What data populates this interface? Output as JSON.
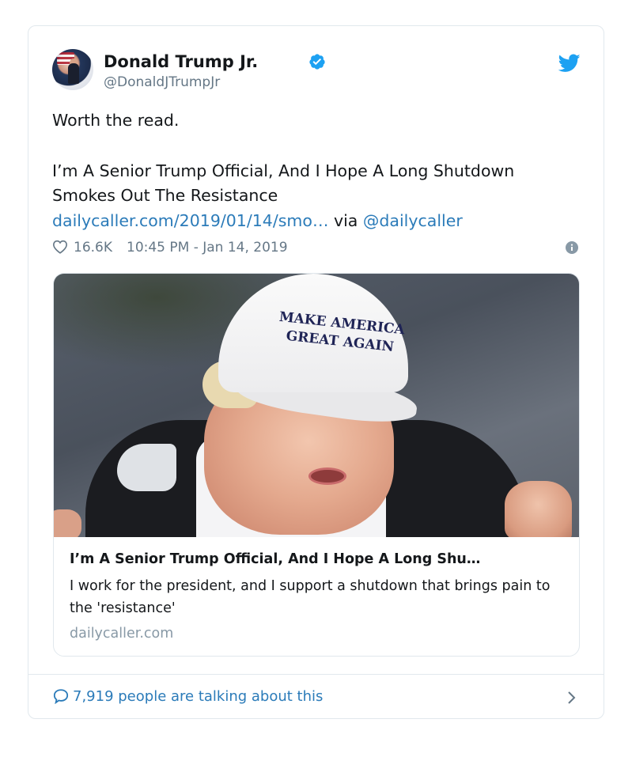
{
  "tweet": {
    "author_name": "Donald Trump Jr.",
    "handle": "@DonaldJTrumpJr",
    "body_lines": [
      "Worth the read.",
      "I’m A Senior Trump Official, And I Hope A Long Shutdown",
      "Smokes Out The Resistance"
    ],
    "link_text": "dailycaller.com/2019/01/14/smo…",
    "via_text": " via ",
    "mention": "@dailycaller",
    "likes": "16.6K",
    "timestamp": "10:45 PM - Jan 14, 2019"
  },
  "card": {
    "image_cap_line1": "MAKE AMERICA",
    "image_cap_line2": "GREAT AGAIN",
    "title": "I’m A Senior Trump Official, And I Hope A Long Shu…",
    "description": "I work for the president, and I support a shutdown that brings pain to the 'resistance'",
    "domain": "dailycaller.com"
  },
  "footer": {
    "talking_text": "7,919 people are talking about this"
  },
  "colors": {
    "link": "#2b7bb9",
    "secondary_text": "#657786",
    "verified_blue": "#1da1f2",
    "border": "#e1e8ed"
  },
  "icons": [
    "verified-badge-icon",
    "twitter-bird-icon",
    "heart-icon",
    "info-icon",
    "comment-bubble-icon",
    "chevron-right-icon"
  ]
}
